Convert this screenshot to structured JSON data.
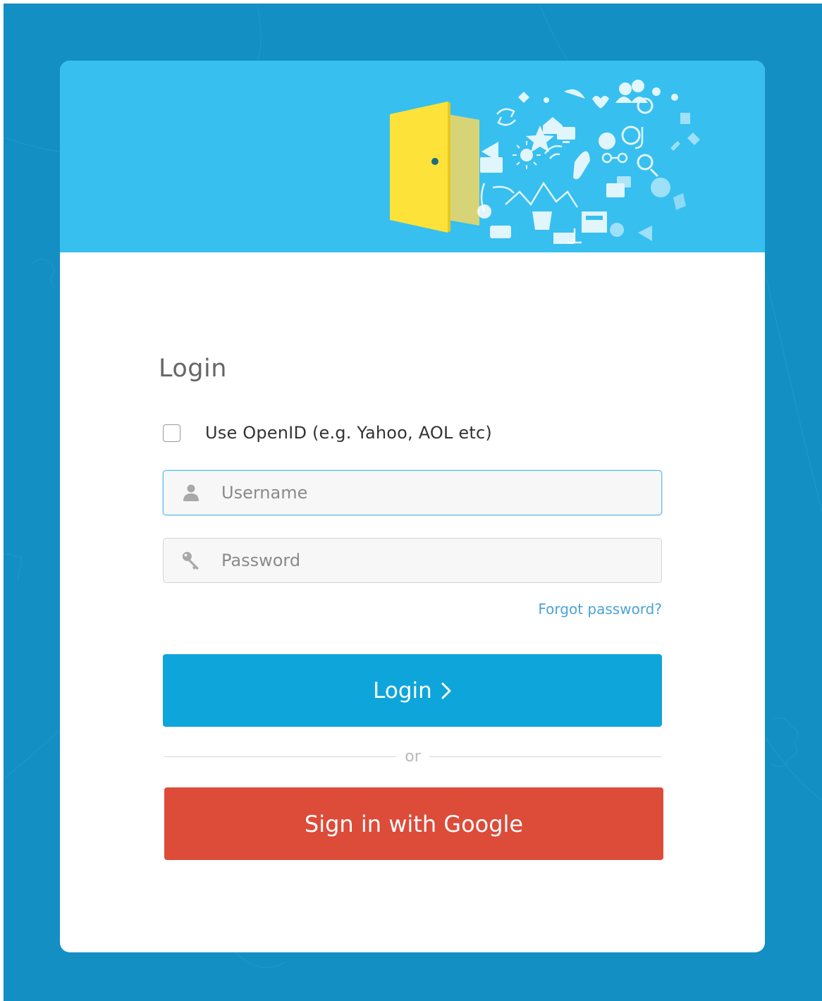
{
  "login_form": {
    "heading": "Login",
    "openid_label": "Use OpenID (e.g. Yahoo, AOL etc)",
    "openid_checked": false,
    "username": {
      "placeholder": "Username",
      "value": "",
      "icon": "user-icon"
    },
    "password": {
      "placeholder": "Password",
      "value": "",
      "icon": "key-icon"
    },
    "forgot_password_label": "Forgot password?",
    "login_button_label": "Login",
    "divider_text": "or",
    "google_button_label": "Sign in with Google"
  },
  "header": {
    "illustration": "open-door-with-icons"
  },
  "colors": {
    "page_background": "#138fc3",
    "header_background": "#37bff0",
    "login_button": "#0ea5db",
    "google_button": "#dd4b39",
    "link": "#4ba3d6",
    "door": "#fde23a"
  }
}
